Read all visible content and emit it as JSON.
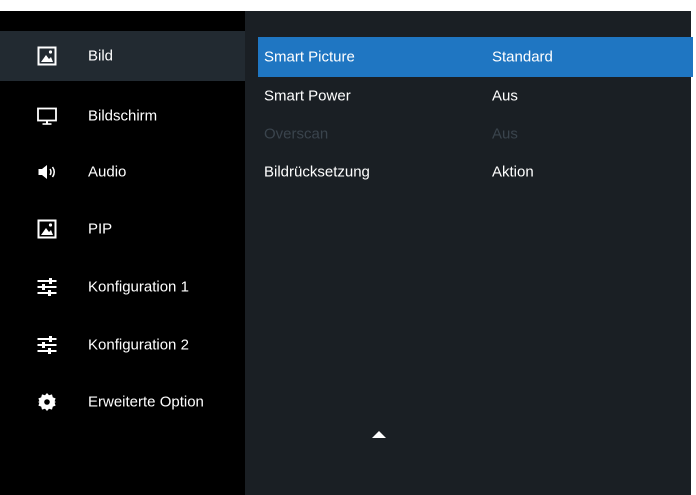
{
  "sidebar": {
    "items": [
      {
        "label": "Bild",
        "icon": "picture-icon",
        "active": true
      },
      {
        "label": "Bildschirm",
        "icon": "monitor-icon"
      },
      {
        "label": "Audio",
        "icon": "speaker-icon"
      },
      {
        "label": "PIP",
        "icon": "picture-icon"
      },
      {
        "label": "Konfiguration 1",
        "icon": "sliders-icon"
      },
      {
        "label": "Konfiguration 2",
        "icon": "sliders-icon"
      },
      {
        "label": "Erweiterte Option",
        "icon": "gear-icon"
      }
    ]
  },
  "settings": {
    "rows": [
      {
        "name": "Smart Picture",
        "value": "Standard",
        "selected": true
      },
      {
        "name": "Smart Power",
        "value": "Aus"
      },
      {
        "name": "Overscan",
        "value": "Aus",
        "disabled": true
      },
      {
        "name": "Bildrücksetzung",
        "value": "Aktion"
      }
    ]
  },
  "colors": {
    "panel_bg": "#1a1f24",
    "sidebar_bg": "#000000",
    "active_item_bg": "#222a31",
    "selection": "#1f76c2",
    "disabled_text": "#3a444d"
  },
  "scroll_indicator_icon": "triangle-up-icon"
}
